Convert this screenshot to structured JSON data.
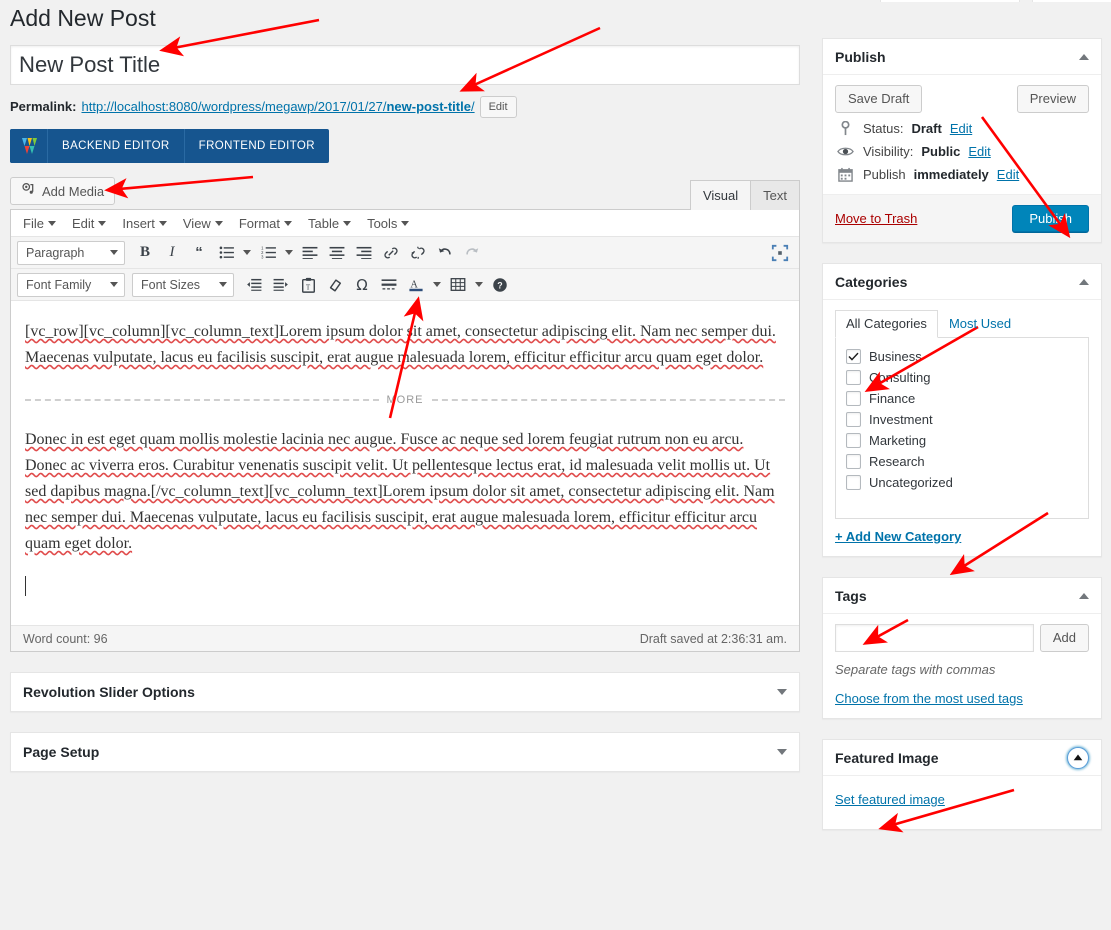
{
  "page": {
    "title": "Add New Post"
  },
  "post": {
    "title_value": "New Post Title",
    "title_placeholder": "Enter title here",
    "permalink_label": "Permalink:",
    "permalink_base": "http://localhost:8080/wordpress/megawp/2017/01/27/",
    "permalink_slug": "new-post-title",
    "permalink_slash": "/",
    "permalink_edit_button": "Edit"
  },
  "vc_bar": {
    "logo_icon": "visual-composer-logo-icon",
    "backend_editor": "BACKEND EDITOR",
    "frontend_editor": "FRONTEND EDITOR"
  },
  "editor": {
    "add_media_label": "Add Media",
    "add_media_icon": "add-media-icon",
    "tabs": [
      {
        "label": "Visual",
        "active": true
      },
      {
        "label": "Text",
        "active": false
      }
    ],
    "menubar": [
      "File",
      "Edit",
      "Insert",
      "View",
      "Format",
      "Table",
      "Tools"
    ],
    "row1": {
      "format_select": "Paragraph",
      "buttons": [
        "bold-icon",
        "italic-icon",
        "blockquote-icon",
        "bullet-list-icon",
        "bullet-list-caret-icon",
        "numbered-list-icon",
        "numbered-list-caret-icon",
        "align-left-icon",
        "align-center-icon",
        "align-right-icon",
        "insert-link-icon",
        "unlink-icon",
        "undo-icon",
        "redo-icon"
      ],
      "fullscreen_icon": "fullscreen-icon"
    },
    "row2": {
      "font_family_select": "Font Family",
      "font_sizes_select": "Font Sizes",
      "buttons": [
        "decrease-indent-icon",
        "increase-indent-icon",
        "paste-as-text-icon",
        "clear-formatting-icon",
        "special-character-icon",
        "horizontal-line-icon",
        "text-color-icon",
        "text-color-caret-icon",
        "table-icon",
        "table-caret-icon",
        "keyboard-shortcuts-icon"
      ]
    },
    "content": {
      "p1": "[vc_row][vc_column][vc_column_text]Lorem ipsum dolor sit amet, consectetur adipiscing elit. Nam nec semper dui. Maecenas vulputate, lacus eu facilisis suscipit, erat augue malesuada lorem, efficitur efficitur arcu quam eget dolor.",
      "more_label": "MORE",
      "p2": "Donec in est eget quam mollis molestie lacinia nec augue. Fusce ac neque sed lorem feugiat rutrum non eu arcu. Donec ac viverra eros. Curabitur venenatis suscipit velit. Ut pellentesque lectus erat, id malesuada velit mollis ut. Ut sed dapibus magna.[/vc_column_text][vc_column_text]Lorem ipsum dolor sit amet, consectetur adipiscing elit. Nam nec semper dui. Maecenas vulputate, lacus eu facilisis suscipit, erat augue malesuada lorem, efficitur efficitur arcu quam eget dolor."
    },
    "statusbar": {
      "word_count": "Word count: 96",
      "draft_saved": "Draft saved at 2:36:31 am."
    }
  },
  "metaboxes": [
    {
      "title": "Revolution Slider Options",
      "collapsed": true
    },
    {
      "title": "Page Setup",
      "collapsed": true
    }
  ],
  "publish": {
    "title": "Publish",
    "toggle_icon": "chevron-up-icon",
    "save_draft": "Save Draft",
    "preview": "Preview",
    "status_icon": "pin-icon",
    "status_label": "Status:",
    "status_value": "Draft",
    "status_edit": "Edit",
    "visibility_icon": "eye-icon",
    "visibility_label": "Visibility:",
    "visibility_value": "Public",
    "visibility_edit": "Edit",
    "schedule_icon": "calendar-icon",
    "schedule_label": "Publish",
    "schedule_value": "immediately",
    "schedule_edit": "Edit",
    "move_to_trash": "Move to Trash",
    "publish_button": "Publish"
  },
  "categories": {
    "title": "Categories",
    "toggle_icon": "chevron-up-icon",
    "tabs": [
      {
        "label": "All Categories",
        "active": true
      },
      {
        "label": "Most Used",
        "active": false
      }
    ],
    "items": [
      {
        "label": "Business",
        "checked": true
      },
      {
        "label": "Consulting",
        "checked": false
      },
      {
        "label": "Finance",
        "checked": false
      },
      {
        "label": "Investment",
        "checked": false
      },
      {
        "label": "Marketing",
        "checked": false
      },
      {
        "label": "Research",
        "checked": false
      },
      {
        "label": "Uncategorized",
        "checked": false
      }
    ],
    "add_new": "+ Add New Category"
  },
  "tags": {
    "title": "Tags",
    "toggle_icon": "chevron-up-icon",
    "input_value": "",
    "input_placeholder": "",
    "add_button": "Add",
    "hint": "Separate tags with commas",
    "most_used_link": "Choose from the most used tags"
  },
  "featured_image": {
    "title": "Featured Image",
    "toggle_icon": "chevron-up-circle-icon",
    "set_link": "Set featured image"
  },
  "colors": {
    "accent_blue": "#0073aa",
    "publish_blue": "#0085ba",
    "vc_navy": "#16558f",
    "trash_red": "#a00",
    "annotation_red": "#ff0000",
    "page_bg": "#f1f1f1"
  }
}
